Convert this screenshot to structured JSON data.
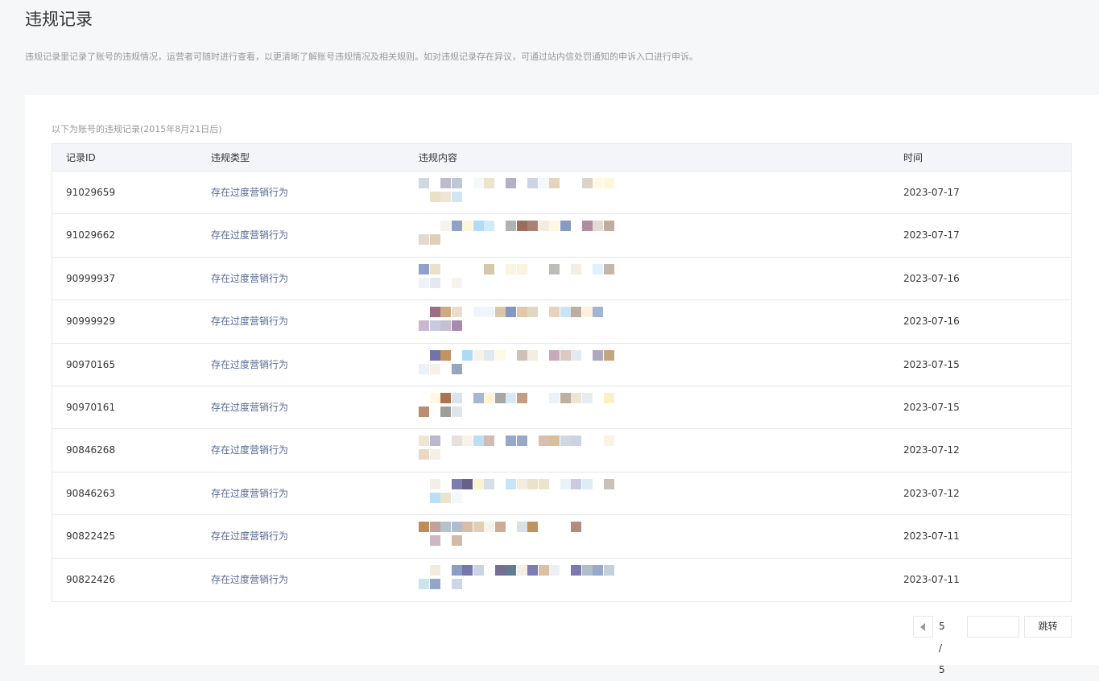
{
  "page": {
    "title": "违规记录",
    "description": "违规记录里记录了账号的违规情况，运营者可随时进行查看，以更清晰了解账号违规情况及相关规则。如对违规记录存在异议，可通过站内信处罚通知的申诉入口进行申诉。"
  },
  "table": {
    "caption": "以下为账号的违规记录(2015年8月21日后)",
    "headers": {
      "id": "记录ID",
      "type": "违规类型",
      "content": "违规内容",
      "time": "时间"
    },
    "rows": [
      {
        "id": "91029659",
        "type": "存在过度营销行为",
        "time": "2023-07-17"
      },
      {
        "id": "91029662",
        "type": "存在过度营销行为",
        "time": "2023-07-17"
      },
      {
        "id": "90999937",
        "type": "存在过度营销行为",
        "time": "2023-07-16"
      },
      {
        "id": "90999929",
        "type": "存在过度营销行为",
        "time": "2023-07-16"
      },
      {
        "id": "90970165",
        "type": "存在过度营销行为",
        "time": "2023-07-15"
      },
      {
        "id": "90970161",
        "type": "存在过度营销行为",
        "time": "2023-07-15"
      },
      {
        "id": "90846268",
        "type": "存在过度营销行为",
        "time": "2023-07-12"
      },
      {
        "id": "90846263",
        "type": "存在过度营销行为",
        "time": "2023-07-12"
      },
      {
        "id": "90822425",
        "type": "存在过度营销行为",
        "time": "2023-07-11"
      },
      {
        "id": "90822426",
        "type": "存在过度营销行为",
        "time": "2023-07-11"
      }
    ]
  },
  "pagination": {
    "indicator": "5 / 5",
    "jump_label": "跳转"
  },
  "colors": {
    "link": "#576b95",
    "border": "#e7e7eb",
    "header_bg": "#f4f5f9"
  }
}
